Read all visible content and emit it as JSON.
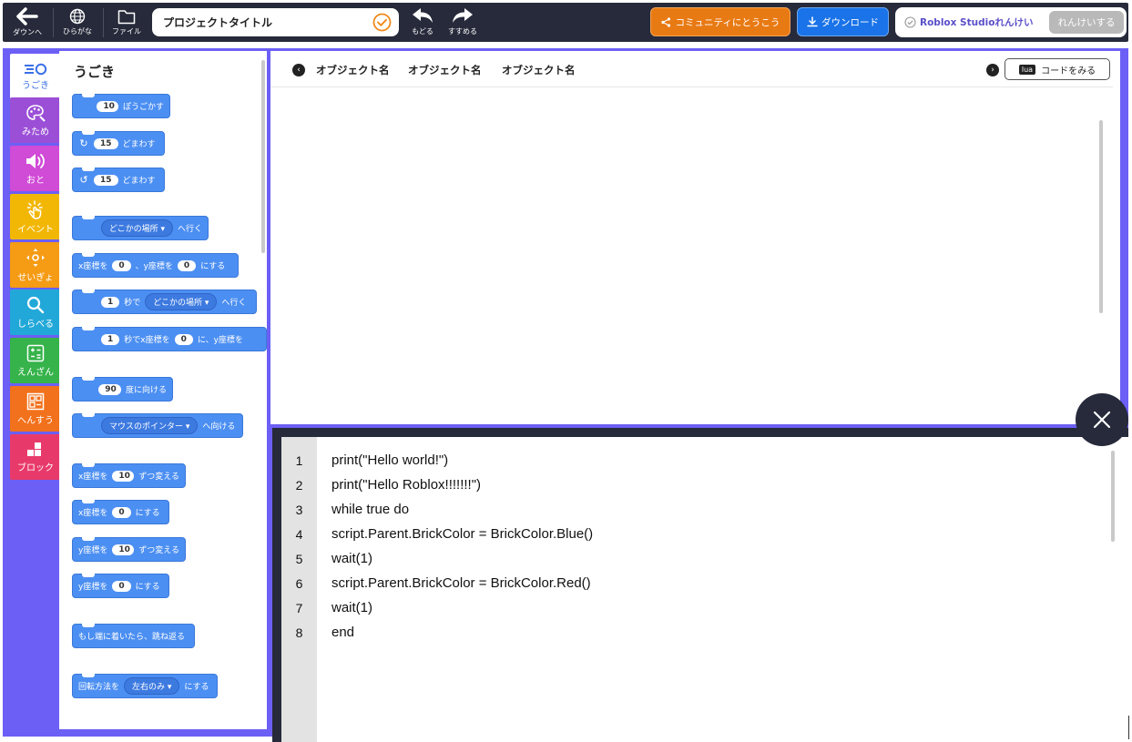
{
  "topbar": {
    "download_label": "ダウンへ",
    "hiragana_label": "ひらがな",
    "file_label": "ファイル",
    "project_title": "プロジェクトタイトル",
    "undo_label": "もどる",
    "redo_label": "すすめる",
    "community_label": "コミュニティにとうこう",
    "download_btn_label": "ダウンロード",
    "studio_label": "Roblox Studioれんけい",
    "link_btn_label": "れんけいする"
  },
  "categories": [
    {
      "label": "うごき",
      "icon": "motion-icon",
      "color": "#ffffff"
    },
    {
      "label": "みため",
      "icon": "looks-icon",
      "color": "#9b4fd6"
    },
    {
      "label": "おと",
      "icon": "sound-icon",
      "color": "#d04bd6"
    },
    {
      "label": "イベント",
      "icon": "event-icon",
      "color": "#f2b705"
    },
    {
      "label": "せいぎょ",
      "icon": "control-icon",
      "color": "#f59b14"
    },
    {
      "label": "しらべる",
      "icon": "search-icon",
      "color": "#22a8d8"
    },
    {
      "label": "えんざん",
      "icon": "operator-icon",
      "color": "#36b34a"
    },
    {
      "label": "へんすう",
      "icon": "variable-icon",
      "color": "#f2711c"
    },
    {
      "label": "ブロック",
      "icon": "block-icon",
      "color": "#e83a6a"
    }
  ],
  "palette": {
    "title": "うごき",
    "blocks": {
      "move": {
        "num": "10",
        "text": "ぽうごかす"
      },
      "turn_right": {
        "num": "15",
        "text": "どまわす"
      },
      "turn_left": {
        "num": "15",
        "text": "どまわす"
      },
      "goto": {
        "dropdown": "どこかの場所",
        "text": "へ行く"
      },
      "set_xy": {
        "pre": "x座標を",
        "x": "0",
        "mid": "、y座標を",
        "y": "0",
        "post": "にする"
      },
      "glide_to": {
        "num": "1",
        "mid": "秒で",
        "dropdown": "どこかの場所",
        "post": "へ行く"
      },
      "glide_xy": {
        "num": "1",
        "mid": "秒でx座標を",
        "x": "0",
        "post": "に、y座標を"
      },
      "point_dir": {
        "num": "90",
        "text": "度に向ける"
      },
      "point_toward": {
        "dropdown": "マウスのポインター",
        "text": "へ向ける"
      },
      "change_x": {
        "pre": "x座標を",
        "num": "10",
        "post": "ずつ変える"
      },
      "set_x": {
        "pre": "x座標を",
        "num": "0",
        "post": "にする"
      },
      "change_y": {
        "pre": "y座標を",
        "num": "10",
        "post": "ずつ変える"
      },
      "set_y": {
        "pre": "y座標を",
        "num": "0",
        "post": "にする"
      },
      "bounce": {
        "text": "もし端に着いたら、跳ね返る"
      },
      "rotation": {
        "pre": "回転方法を",
        "dropdown": "左右のみ",
        "post": "にする"
      }
    }
  },
  "stage": {
    "objects": [
      "オブジェクト名",
      "オブジェクト名",
      "オブジェクト名"
    ],
    "lua_tag": "lua",
    "code_btn_label": "コードをみる"
  },
  "code": {
    "lines": [
      {
        "n": "1",
        "text": "print(\"Hello world!\")"
      },
      {
        "n": "2",
        "text": "print(\"Hello Roblox!!!!!!!\")"
      },
      {
        "n": "3",
        "text": "while true do"
      },
      {
        "n": "4",
        "text": "script.Parent.BrickColor = BrickColor.Blue()"
      },
      {
        "n": "5",
        "text": "wait(1)"
      },
      {
        "n": "6",
        "text": "script.Parent.BrickColor = BrickColor.Red()"
      },
      {
        "n": "7",
        "text": "wait(1)"
      },
      {
        "n": "8",
        "text": "end"
      }
    ]
  },
  "colors": {
    "topbar": "#262a3a",
    "frame": "#6c5ff5",
    "block": "#4c8ff2",
    "community": "#e87a14",
    "download": "#1a73e8",
    "check": "#f08a1c"
  }
}
